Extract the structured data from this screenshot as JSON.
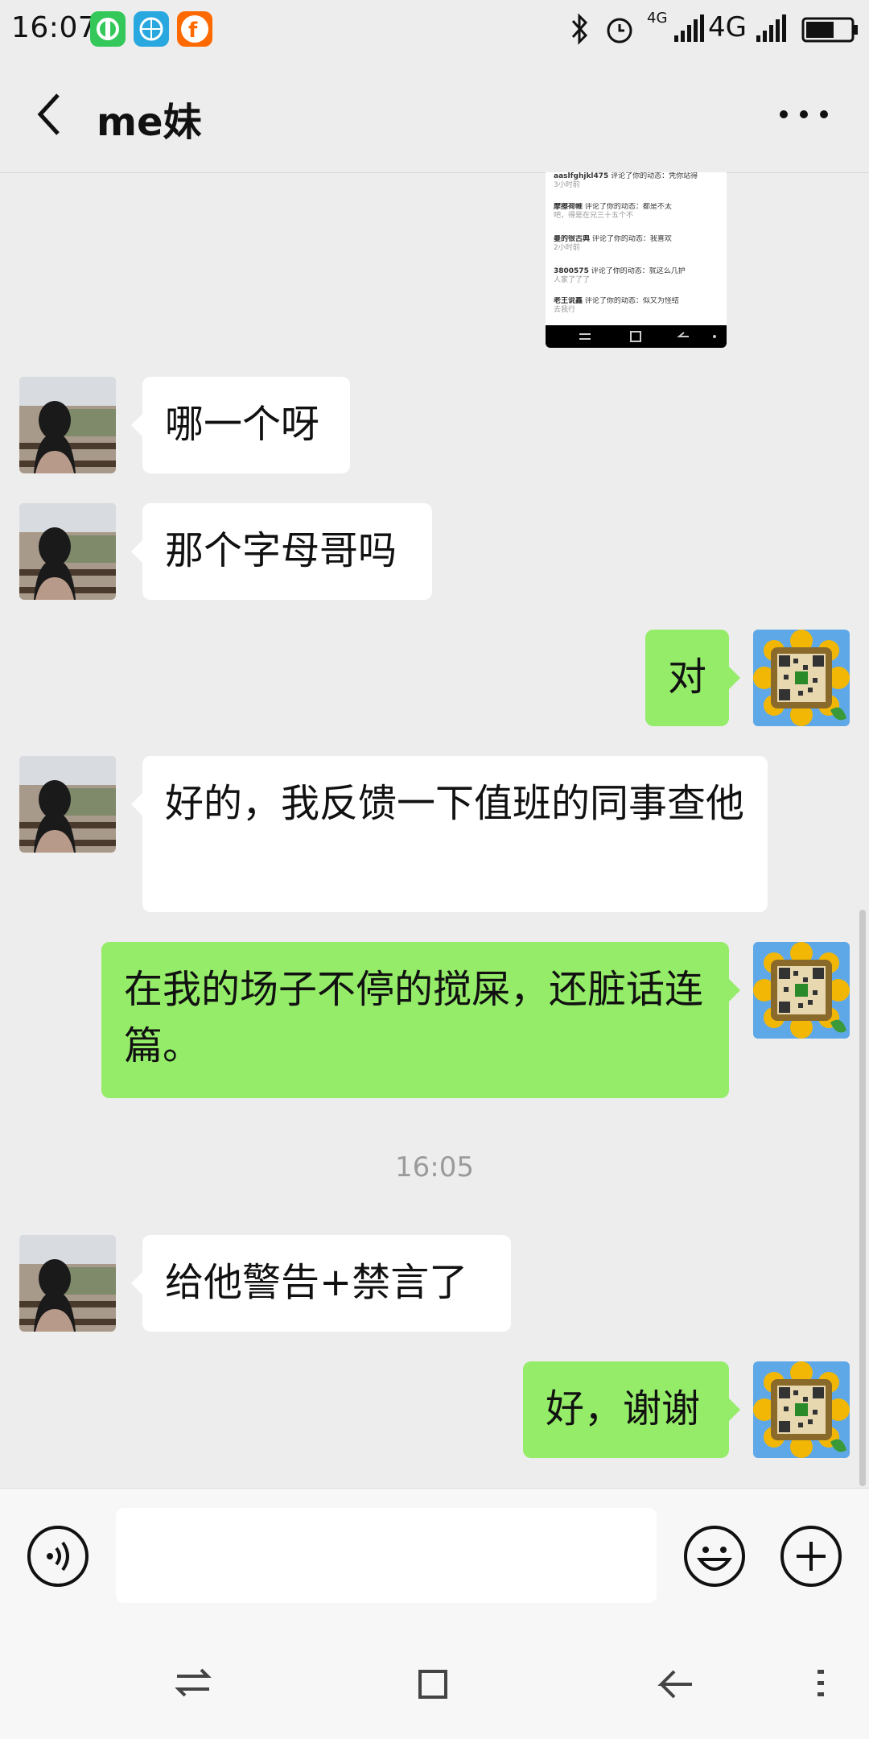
{
  "status_bar": {
    "time": "16:07",
    "network_1": "4G",
    "network_2": "4G"
  },
  "header": {
    "title": "me妹",
    "back_icon": "chevron-left-icon",
    "more_icon": "more-dots-icon"
  },
  "chat": {
    "screenshot_rows": [
      {
        "name": "aaslfghjkl475",
        "text": "评论了你的动态：凭你站得",
        "sub": "3小时前"
      },
      {
        "name": "摩擦荷帷",
        "text": "评论了你的动态：都是不太",
        "sub": "吧，得是在兄三十五个不"
      },
      {
        "name": "曼的很古典",
        "text": "评论了你的动态：我喜欢",
        "sub": "2小时前"
      },
      {
        "name": "3800575",
        "text": "评论了你的动态：就这么几护",
        "sub": "人家了了了"
      },
      {
        "name": "老王说鑫",
        "text": "评论了你的动态：似又为怪结",
        "sub": "去我行"
      }
    ],
    "messages": [
      {
        "dir": "in",
        "text": "哪一个呀"
      },
      {
        "dir": "in",
        "text": "那个字母哥吗"
      },
      {
        "dir": "out",
        "text": "对"
      },
      {
        "dir": "in",
        "text": "好的，我反馈一下值班的同事查他"
      },
      {
        "dir": "out",
        "text": "在我的场子不停的搅屎，还脏话连篇。"
      },
      {
        "dir": "in",
        "text": "给他警告+禁言了"
      },
      {
        "dir": "out",
        "text": "好，谢谢"
      }
    ],
    "timestamp": "16:05"
  },
  "input_bar": {
    "value": "",
    "voice_icon": "voice-icon",
    "emoji_icon": "emoji-icon",
    "plus_icon": "plus-icon"
  },
  "colors": {
    "background": "#ededed",
    "outgoing_bubble": "#95ec69",
    "incoming_bubble": "#ffffff"
  }
}
